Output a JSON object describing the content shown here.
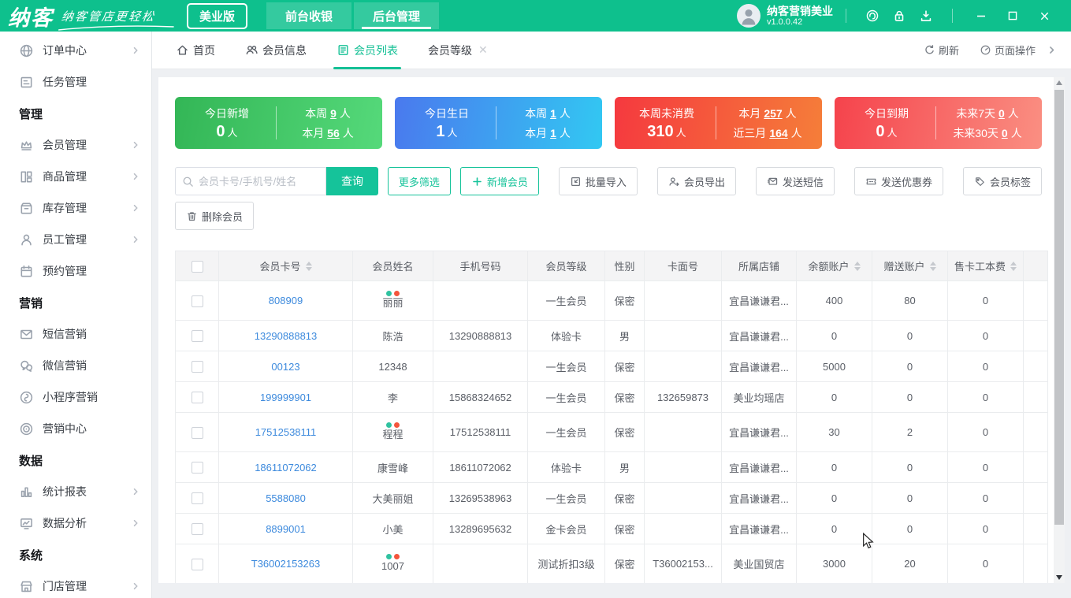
{
  "header": {
    "logo": "纳客",
    "tagline": "纳客管店更轻松",
    "edition": "美业版",
    "nav_tabs": [
      {
        "label": "前台收银",
        "active": false
      },
      {
        "label": "后台管理",
        "active": true
      }
    ],
    "account": {
      "name": "纳客营销美业",
      "version": "v1.0.0.42"
    }
  },
  "sidebar": {
    "items": [
      {
        "type": "item",
        "label": "订单中心",
        "icon": "globe",
        "chevron": true
      },
      {
        "type": "item",
        "label": "任务管理",
        "icon": "task",
        "chevron": false
      },
      {
        "type": "section",
        "label": "管理"
      },
      {
        "type": "item",
        "label": "会员管理",
        "icon": "crown",
        "chevron": true
      },
      {
        "type": "item",
        "label": "商品管理",
        "icon": "goods",
        "chevron": true
      },
      {
        "type": "item",
        "label": "库存管理",
        "icon": "inventory",
        "chevron": true
      },
      {
        "type": "item",
        "label": "员工管理",
        "icon": "staff",
        "chevron": true
      },
      {
        "type": "item",
        "label": "预约管理",
        "icon": "calendar",
        "chevron": false
      },
      {
        "type": "section",
        "label": "营销"
      },
      {
        "type": "item",
        "label": "短信营销",
        "icon": "mail",
        "chevron": false
      },
      {
        "type": "item",
        "label": "微信营销",
        "icon": "wechat",
        "chevron": false
      },
      {
        "type": "item",
        "label": "小程序营销",
        "icon": "miniapp",
        "chevron": false
      },
      {
        "type": "item",
        "label": "营销中心",
        "icon": "target",
        "chevron": false
      },
      {
        "type": "section",
        "label": "数据"
      },
      {
        "type": "item",
        "label": "统计报表",
        "icon": "bars",
        "chevron": true
      },
      {
        "type": "item",
        "label": "数据分析",
        "icon": "monitor",
        "chevron": true
      },
      {
        "type": "section",
        "label": "系统"
      },
      {
        "type": "item",
        "label": "门店管理",
        "icon": "store",
        "chevron": true
      }
    ]
  },
  "tabbar": {
    "tabs": [
      {
        "label": "首页",
        "icon": "home",
        "active": false,
        "closable": false
      },
      {
        "label": "会员信息",
        "icon": "members",
        "active": false,
        "closable": false
      },
      {
        "label": "会员列表",
        "icon": "list",
        "active": true,
        "closable": false
      },
      {
        "label": "会员等级",
        "icon": "",
        "active": false,
        "closable": true
      }
    ],
    "refresh_label": "刷新",
    "page_ops_label": "页面操作"
  },
  "stats_cards": [
    {
      "title": "今日新增",
      "value": "0",
      "unit": "人",
      "rows": [
        {
          "label": "本周",
          "value": "9",
          "unit": "人"
        },
        {
          "label": "本月",
          "value": "56",
          "unit": "人"
        }
      ],
      "gradient": [
        "#33b656",
        "#55d97a"
      ]
    },
    {
      "title": "今日生日",
      "value": "1",
      "unit": "人",
      "rows": [
        {
          "label": "本周",
          "value": "1",
          "unit": "人"
        },
        {
          "label": "本月",
          "value": "1",
          "unit": "人"
        }
      ],
      "gradient": [
        "#4a79ee",
        "#32c8f2"
      ]
    },
    {
      "title": "本周未消费",
      "value": "310",
      "unit": "人",
      "rows": [
        {
          "label": "本月",
          "value": "257",
          "unit": "人"
        },
        {
          "label": "近三月",
          "value": "164",
          "unit": "人"
        }
      ],
      "gradient": [
        "#f5393f",
        "#f57e39"
      ]
    },
    {
      "title": "今日到期",
      "value": "0",
      "unit": "人",
      "rows": [
        {
          "label": "未来7天",
          "value": "0",
          "unit": "人"
        },
        {
          "label": "未来30天",
          "value": "0",
          "unit": "人"
        }
      ],
      "gradient": [
        "#f5434c",
        "#fa8f82"
      ]
    }
  ],
  "toolbar": {
    "search": {
      "placeholder": "会员卡号/手机号/姓名",
      "button": "查询"
    },
    "buttons": [
      {
        "label": "更多筛选",
        "style": "green",
        "icon": ""
      },
      {
        "label": "新增会员",
        "style": "green",
        "icon": "plus"
      },
      {
        "label": "批量导入",
        "style": "gray",
        "icon": "import"
      },
      {
        "label": "会员导出",
        "style": "gray",
        "icon": "exportUser"
      },
      {
        "label": "发送短信",
        "style": "gray",
        "icon": "sms"
      },
      {
        "label": "发送优惠券",
        "style": "gray",
        "icon": "coupon"
      },
      {
        "label": "会员标签",
        "style": "gray",
        "icon": "tag"
      }
    ],
    "row2": [
      {
        "label": "删除会员",
        "style": "gray",
        "icon": "trash"
      }
    ]
  },
  "table": {
    "columns": [
      {
        "label": "会员卡号",
        "sortable": true
      },
      {
        "label": "会员姓名",
        "sortable": false
      },
      {
        "label": "手机号码",
        "sortable": false
      },
      {
        "label": "会员等级",
        "sortable": false
      },
      {
        "label": "性别",
        "sortable": false
      },
      {
        "label": "卡面号",
        "sortable": false
      },
      {
        "label": "所属店铺",
        "sortable": false
      },
      {
        "label": "余额账户",
        "sortable": true
      },
      {
        "label": "赠送账户",
        "sortable": true
      },
      {
        "label": "售卡工本费",
        "sortable": true
      }
    ],
    "dot_colors": [
      "#2fc2a0",
      "#f4553c"
    ],
    "rows": [
      {
        "card_no": "808909",
        "name": "丽丽",
        "has_dots": true,
        "phone": "",
        "level": "一生会员",
        "gender": "保密",
        "card_face": "",
        "store": "宜昌谦谦君...",
        "balance": "400",
        "gift": "80",
        "fee": "0"
      },
      {
        "card_no": "13290888813",
        "name": "陈浩",
        "has_dots": false,
        "phone": "13290888813",
        "level": "体验卡",
        "gender": "男",
        "card_face": "",
        "store": "宜昌谦谦君...",
        "balance": "0",
        "gift": "0",
        "fee": "0"
      },
      {
        "card_no": "00123",
        "name": "12348",
        "has_dots": false,
        "phone": "",
        "level": "一生会员",
        "gender": "保密",
        "card_face": "",
        "store": "宜昌谦谦君...",
        "balance": "5000",
        "gift": "0",
        "fee": "0"
      },
      {
        "card_no": "199999901",
        "name": "李",
        "has_dots": false,
        "phone": "15868324652",
        "level": "一生会员",
        "gender": "保密",
        "card_face": "132659873",
        "store": "美业均瑶店",
        "balance": "0",
        "gift": "0",
        "fee": "0"
      },
      {
        "card_no": "17512538111",
        "name": "程程",
        "has_dots": true,
        "phone": "17512538111",
        "level": "一生会员",
        "gender": "保密",
        "card_face": "",
        "store": "宜昌谦谦君...",
        "balance": "30",
        "gift": "2",
        "fee": "0"
      },
      {
        "card_no": "18611072062",
        "name": "康雪峰",
        "has_dots": false,
        "phone": "18611072062",
        "level": "体验卡",
        "gender": "男",
        "card_face": "",
        "store": "宜昌谦谦君...",
        "balance": "0",
        "gift": "0",
        "fee": "0"
      },
      {
        "card_no": "5588080",
        "name": "大美丽姐",
        "has_dots": false,
        "phone": "13269538963",
        "level": "一生会员",
        "gender": "保密",
        "card_face": "",
        "store": "宜昌谦谦君...",
        "balance": "0",
        "gift": "0",
        "fee": "0"
      },
      {
        "card_no": "8899001",
        "name": "小美",
        "has_dots": false,
        "phone": "13289695632",
        "level": "金卡会员",
        "gender": "保密",
        "card_face": "",
        "store": "宜昌谦谦君...",
        "balance": "0",
        "gift": "0",
        "fee": "0"
      },
      {
        "card_no": "T36002153263",
        "name": "1007",
        "has_dots": true,
        "phone": "",
        "level": "测试折扣3级",
        "gender": "保密",
        "card_face": "T36002153...",
        "store": "美业国贸店",
        "balance": "3000",
        "gift": "20",
        "fee": "0"
      }
    ]
  },
  "colors": {
    "header_green": "#0ec08d",
    "accent_green": "#15c39a",
    "link_blue": "#3d8add"
  }
}
